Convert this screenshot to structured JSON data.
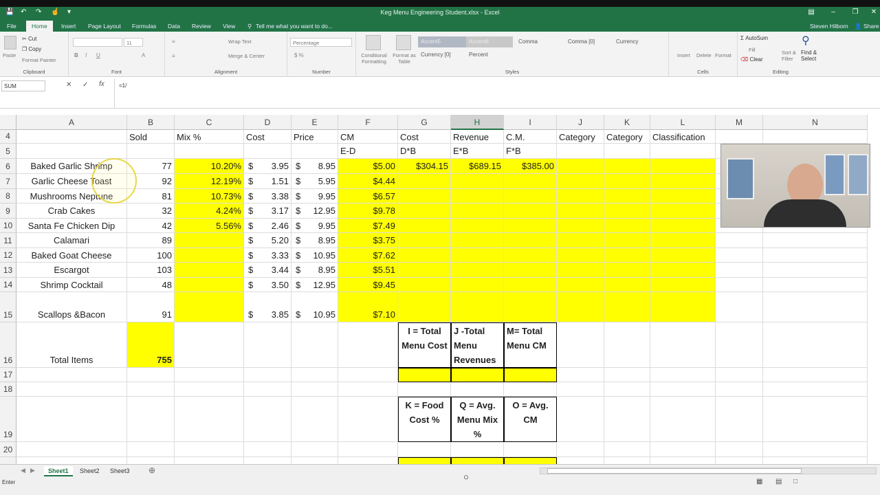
{
  "window": {
    "title": "Keg Menu Engineering Student.xlsx - Excel",
    "user": "Steven Hilborn",
    "share": "Share"
  },
  "menu_tabs": [
    "File",
    "Home",
    "Insert",
    "Page Layout",
    "Formulas",
    "Data",
    "Review",
    "View"
  ],
  "tell_me": "Tell me what you want to do...",
  "ribbon": {
    "clipboard": {
      "paste": "Paste",
      "cut": "Cut",
      "copy": "Copy",
      "painter": "Format Painter",
      "label": "Clipboard"
    },
    "font": {
      "size": "11",
      "label": "Font"
    },
    "alignment": {
      "wrap": "Wrap Text",
      "merge": "Merge & Center",
      "label": "Alignment"
    },
    "number": {
      "format": "Percentage",
      "label": "Number"
    },
    "styles": {
      "cond": "Conditional Formatting",
      "fmt_table": "Format as Table",
      "accent5": "Accent5",
      "accent6": "Accent6",
      "comma": "Comma",
      "comma0": "Comma [0]",
      "currency": "Currency",
      "currency0": "Currency [0]",
      "percent": "Percent",
      "label": "Styles"
    },
    "cells": {
      "insert": "Insert",
      "delete": "Delete",
      "format": "Format",
      "label": "Cells"
    },
    "editing": {
      "autosum": "AutoSum",
      "fill": "Fill",
      "clear": "Clear",
      "sort": "Sort & Filter",
      "find": "Find & Select",
      "label": "Editing"
    }
  },
  "formula_bar": {
    "name_box": "SUM",
    "formula": "=1/"
  },
  "columns": [
    "A",
    "B",
    "C",
    "D",
    "E",
    "F",
    "G",
    "H",
    "I",
    "J",
    "K",
    "L",
    "M",
    "N"
  ],
  "headers": {
    "sold": "Sold",
    "mix": "Mix %",
    "cost": "Cost",
    "price": "Price",
    "cm": "CM",
    "g_cost": "Cost",
    "h_rev": "Revenue",
    "i_cm": "C.M.",
    "j_cat": "Category",
    "k_cat": "Category",
    "l_class": "Classification",
    "f5": "E-D",
    "g5": "D*B",
    "h5": "E*B",
    "i5": "F*B"
  },
  "rows": [
    {
      "num": "6",
      "name": "Baked Garlic Shrimp",
      "sold": "77",
      "mix": "10.20%",
      "cost": "3.95",
      "price": "8.95",
      "cm": "$5.00",
      "g": "$304.15",
      "h": "$689.15",
      "i": "$385.00"
    },
    {
      "num": "7",
      "name": "Garlic Cheese Toast",
      "sold": "92",
      "mix": "12.19%",
      "cost": "1.51",
      "price": "5.95",
      "cm": "$4.44"
    },
    {
      "num": "8",
      "name": "Mushrooms Neptune",
      "sold": "81",
      "mix": "10.73%",
      "cost": "3.38",
      "price": "9.95",
      "cm": "$6.57"
    },
    {
      "num": "9",
      "name": "Crab Cakes",
      "sold": "32",
      "mix": "4.24%",
      "cost": "3.17",
      "price": "12.95",
      "cm": "$9.78"
    },
    {
      "num": "10",
      "name": "Santa Fe Chicken Dip",
      "sold": "42",
      "mix": "5.56%",
      "cost": "2.46",
      "price": "9.95",
      "cm": "$7.49"
    },
    {
      "num": "11",
      "name": "Calamari",
      "sold": "89",
      "mix": "",
      "cost": "5.20",
      "price": "8.95",
      "cm": "$3.75"
    },
    {
      "num": "12",
      "name": "Baked Goat Cheese",
      "sold": "100",
      "mix": "",
      "cost": "3.33",
      "price": "10.95",
      "cm": "$7.62"
    },
    {
      "num": "13",
      "name": "Escargot",
      "sold": "103",
      "mix": "",
      "cost": "3.44",
      "price": "8.95",
      "cm": "$5.51"
    },
    {
      "num": "14",
      "name": "Shrimp Cocktail",
      "sold": "48",
      "mix": "",
      "cost": "3.50",
      "price": "12.95",
      "cm": "$9.45"
    }
  ],
  "row15": {
    "num": "15",
    "name": "Scallops &Bacon",
    "sold": "91",
    "cost": "3.85",
    "price": "10.95",
    "cm": "$7.10"
  },
  "row16": {
    "num": "16",
    "label": "Total Items",
    "total": "755",
    "g": "I = Total Menu Cost",
    "h": "J -Total Menu Revenues",
    "i": "M= Total Menu CM"
  },
  "row19": {
    "g": "K  = Food Cost %",
    "h": "Q = Avg. Menu Mix %",
    "i": "O = Avg. CM"
  },
  "row_nums": {
    "r4": "4",
    "r5": "5",
    "r17": "17",
    "r18": "18",
    "r19": "19",
    "r20": "20"
  },
  "currency_symbol": "$",
  "sheets": [
    "Sheet1",
    "Sheet2",
    "Sheet3"
  ],
  "status": "Enter"
}
